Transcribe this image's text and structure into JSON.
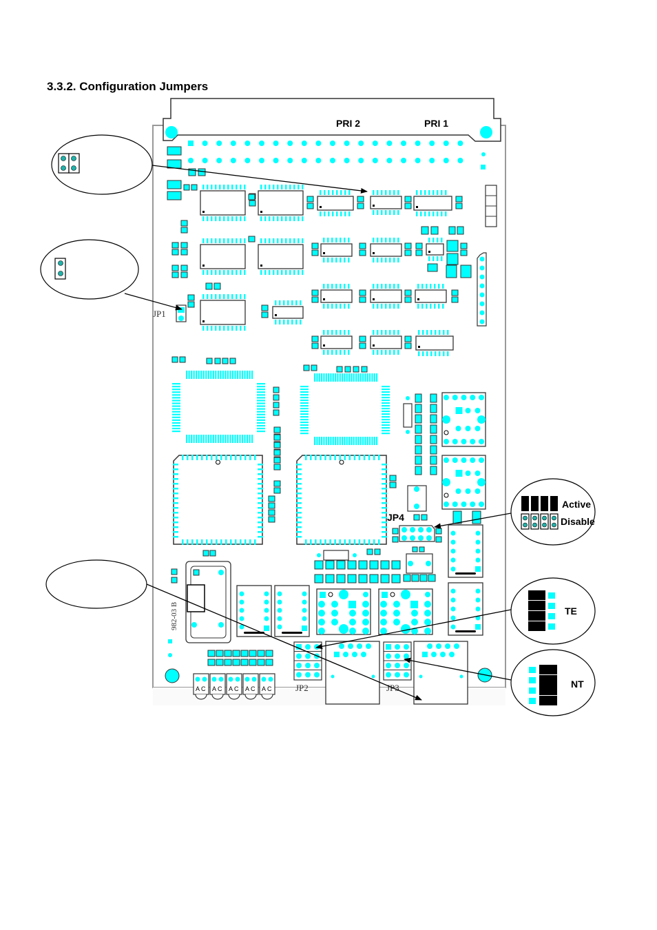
{
  "document": {
    "section_heading": "3.3.2.  Configuration Jumpers"
  },
  "board": {
    "connector_labels": [
      "PRI 2",
      "PRI 1"
    ],
    "jumper_labels": {
      "jp1": "JP1",
      "jp2": "JP2",
      "jp3": "JP3",
      "jp4": "JP4"
    },
    "silkscreen_text": "982-03 B",
    "led_pin_label": "A C",
    "colors": {
      "pad": "#00FFFF",
      "outline": "#333333",
      "board_edge": "#999999",
      "jumper_closed": "#000000",
      "background": "#FFFFFF"
    }
  },
  "callouts": {
    "top_left": {
      "icon": "jumper-2x2-open-icon",
      "label": ""
    },
    "jp1": {
      "icon": "jumper-1x2-open-icon",
      "label": ""
    },
    "jp4": {
      "options": [
        {
          "icon": "jumper-closed-icon",
          "label": "Active"
        },
        {
          "icon": "jumper-open-icon",
          "label": "Disable"
        }
      ]
    },
    "te": {
      "icon": "jumper-te-icon",
      "label": "TE"
    },
    "nt": {
      "icon": "jumper-nt-icon",
      "label": "NT"
    },
    "bottom_left": {
      "label": ""
    }
  }
}
